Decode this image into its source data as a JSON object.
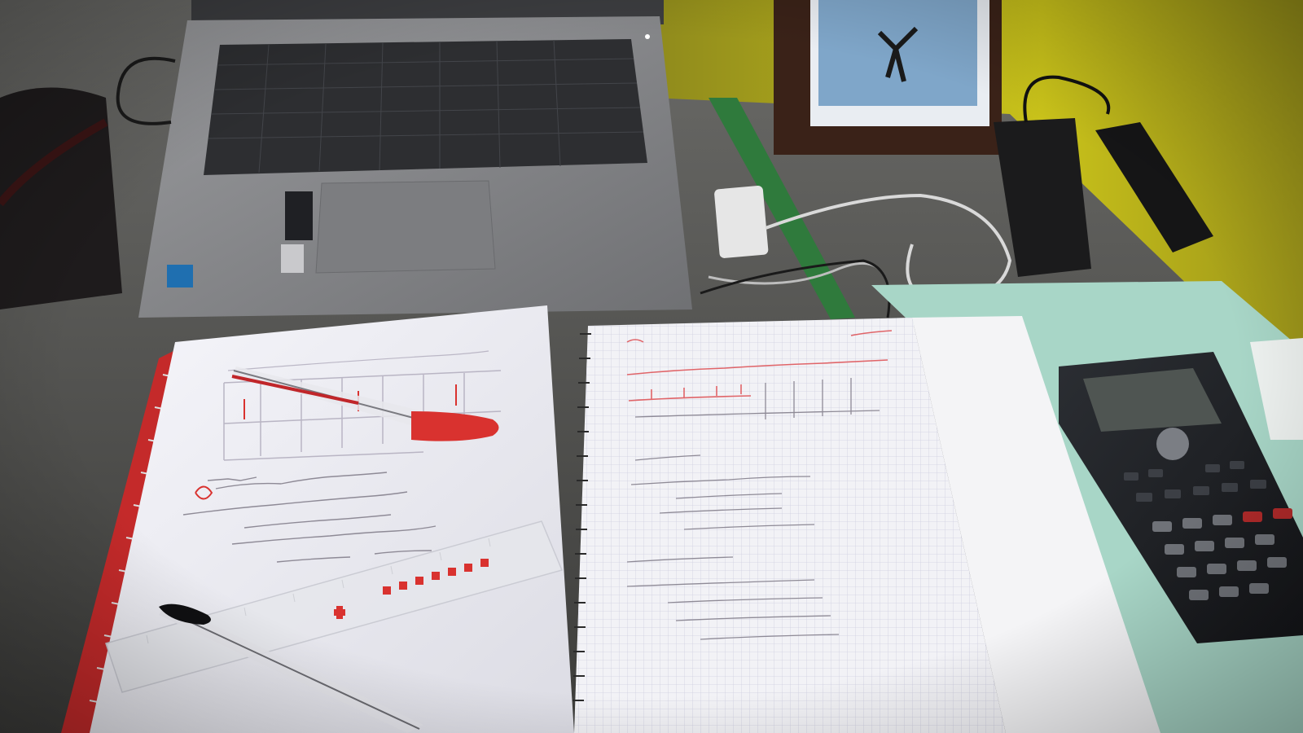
{
  "scene": {
    "wall_color": "#c9c21a",
    "desk_color": "#5b5b58",
    "laptop_color": "#8a8b8d",
    "keyboard_color": "#2d2e31",
    "paper_color": "#efeff4",
    "ink_red": "#d9322f",
    "ink_pencil": "#8e8a96",
    "calculator_color": "#1e2024",
    "folder_color": "#a8d6c7",
    "ruler_green": "#2f7a3c"
  },
  "objects": [
    "laptop",
    "photo-frame",
    "phone-charger",
    "power-adapter",
    "printed-worksheet",
    "red-pen",
    "clear-ruler",
    "black-pen",
    "grid-notebook",
    "scientific-calculator",
    "green-folder"
  ]
}
